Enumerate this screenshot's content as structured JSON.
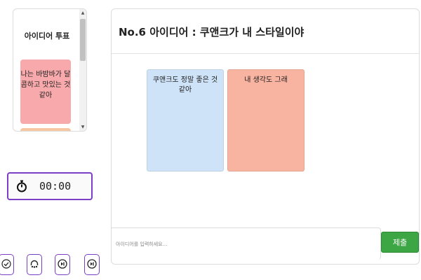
{
  "vote_panel": {
    "title": "아이디어 투표",
    "cards": [
      {
        "text": "나는 바밤바가 달콤하고 맛있는 것 같아",
        "color": "#f8a9ab"
      },
      {
        "text": "",
        "color": "#f6c7a0"
      }
    ]
  },
  "timer": {
    "icon": "stopwatch-icon",
    "time": "00:00",
    "accent": "#7b3fc7"
  },
  "tools": [
    {
      "icon": "check-circle-icon"
    },
    {
      "icon": "headset-icon"
    },
    {
      "icon": "skip-next-icon"
    },
    {
      "icon": "skip-next-icon"
    }
  ],
  "board": {
    "title": "No.6 아이디어 : 쿠앤크가 내 스타일이야",
    "cards": [
      {
        "text": "쿠앤크도 정말 좋은 것 같아",
        "color": "#cfe3f8"
      },
      {
        "text": "내 생각도 그래",
        "color": "#f8b4a1"
      }
    ],
    "input": {
      "placeholder": "아이디어를 입력하세요...",
      "value": ""
    },
    "submit_label": "제출",
    "submit_color": "#3ca544"
  }
}
